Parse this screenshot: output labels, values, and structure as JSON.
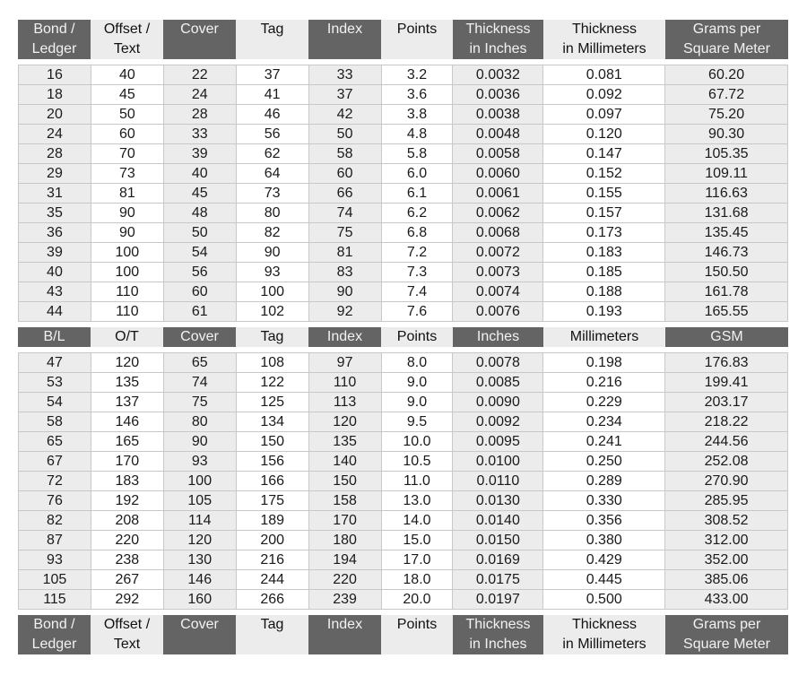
{
  "headers_full": [
    {
      "line1": "Bond /",
      "line2": "Ledger"
    },
    {
      "line1": "Offset /",
      "line2": "Text"
    },
    {
      "line1": "Cover",
      "line2": ""
    },
    {
      "line1": "Tag",
      "line2": ""
    },
    {
      "line1": "Index",
      "line2": ""
    },
    {
      "line1": "Points",
      "line2": ""
    },
    {
      "line1": "Thickness",
      "line2": "in Inches"
    },
    {
      "line1": "Thickness",
      "line2": "in Millimeters"
    },
    {
      "line1": "Grams per",
      "line2": "Square Meter"
    }
  ],
  "headers_short": [
    "B/L",
    "O/T",
    "Cover",
    "Tag",
    "Index",
    "Points",
    "Inches",
    "Millimeters",
    "GSM"
  ],
  "header_styles": [
    "dark",
    "light",
    "dark",
    "light",
    "dark",
    "light",
    "dark",
    "light",
    "dark"
  ],
  "colors": {
    "header_dark": "#646464",
    "header_light": "#ececec",
    "row_shade": "#ececec",
    "grid": "#c8c8c8"
  },
  "table_top": [
    [
      "16",
      "40",
      "22",
      "37",
      "33",
      "3.2",
      "0.0032",
      "0.081",
      "60.20"
    ],
    [
      "18",
      "45",
      "24",
      "41",
      "37",
      "3.6",
      "0.0036",
      "0.092",
      "67.72"
    ],
    [
      "20",
      "50",
      "28",
      "46",
      "42",
      "3.8",
      "0.0038",
      "0.097",
      "75.20"
    ],
    [
      "24",
      "60",
      "33",
      "56",
      "50",
      "4.8",
      "0.0048",
      "0.120",
      "90.30"
    ],
    [
      "28",
      "70",
      "39",
      "62",
      "58",
      "5.8",
      "0.0058",
      "0.147",
      "105.35"
    ],
    [
      "29",
      "73",
      "40",
      "64",
      "60",
      "6.0",
      "0.0060",
      "0.152",
      "109.11"
    ],
    [
      "31",
      "81",
      "45",
      "73",
      "66",
      "6.1",
      "0.0061",
      "0.155",
      "116.63"
    ],
    [
      "35",
      "90",
      "48",
      "80",
      "74",
      "6.2",
      "0.0062",
      "0.157",
      "131.68"
    ],
    [
      "36",
      "90",
      "50",
      "82",
      "75",
      "6.8",
      "0.0068",
      "0.173",
      "135.45"
    ],
    [
      "39",
      "100",
      "54",
      "90",
      "81",
      "7.2",
      "0.0072",
      "0.183",
      "146.73"
    ],
    [
      "40",
      "100",
      "56",
      "93",
      "83",
      "7.3",
      "0.0073",
      "0.185",
      "150.50"
    ],
    [
      "43",
      "110",
      "60",
      "100",
      "90",
      "7.4",
      "0.0074",
      "0.188",
      "161.78"
    ],
    [
      "44",
      "110",
      "61",
      "102",
      "92",
      "7.6",
      "0.0076",
      "0.193",
      "165.55"
    ]
  ],
  "table_bottom": [
    [
      "47",
      "120",
      "65",
      "108",
      "97",
      "8.0",
      "0.0078",
      "0.198",
      "176.83"
    ],
    [
      "53",
      "135",
      "74",
      "122",
      "110",
      "9.0",
      "0.0085",
      "0.216",
      "199.41"
    ],
    [
      "54",
      "137",
      "75",
      "125",
      "113",
      "9.0",
      "0.0090",
      "0.229",
      "203.17"
    ],
    [
      "58",
      "146",
      "80",
      "134",
      "120",
      "9.5",
      "0.0092",
      "0.234",
      "218.22"
    ],
    [
      "65",
      "165",
      "90",
      "150",
      "135",
      "10.0",
      "0.0095",
      "0.241",
      "244.56"
    ],
    [
      "67",
      "170",
      "93",
      "156",
      "140",
      "10.5",
      "0.0100",
      "0.250",
      "252.08"
    ],
    [
      "72",
      "183",
      "100",
      "166",
      "150",
      "11.0",
      "0.0110",
      "0.289",
      "270.90"
    ],
    [
      "76",
      "192",
      "105",
      "175",
      "158",
      "13.0",
      "0.0130",
      "0.330",
      "285.95"
    ],
    [
      "82",
      "208",
      "114",
      "189",
      "170",
      "14.0",
      "0.0140",
      "0.356",
      "308.52"
    ],
    [
      "87",
      "220",
      "120",
      "200",
      "180",
      "15.0",
      "0.0150",
      "0.380",
      "312.00"
    ],
    [
      "93",
      "238",
      "130",
      "216",
      "194",
      "17.0",
      "0.0169",
      "0.429",
      "352.00"
    ],
    [
      "105",
      "267",
      "146",
      "244",
      "220",
      "18.0",
      "0.0175",
      "0.445",
      "385.06"
    ],
    [
      "115",
      "292",
      "160",
      "266",
      "239",
      "20.0",
      "0.0197",
      "0.500",
      "433.00"
    ]
  ]
}
